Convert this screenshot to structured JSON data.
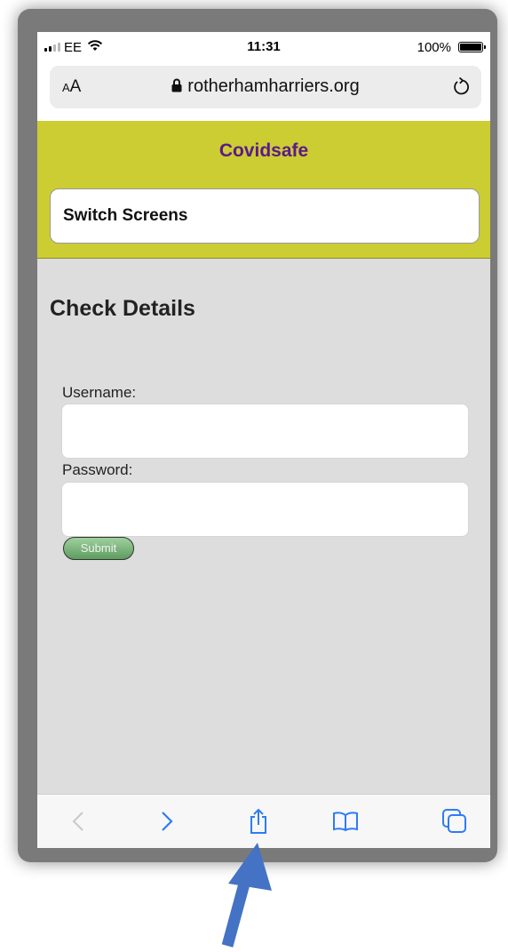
{
  "status_bar": {
    "carrier": "EE",
    "time": "11:31",
    "battery": "100%"
  },
  "browser": {
    "text_size_button": "AA",
    "url": "rotherhamharriers.org"
  },
  "app": {
    "title": "Covidsafe",
    "title_color": "#5a1a8a",
    "header_color": "#cccc33",
    "switch_screens_label": "Switch Screens"
  },
  "page": {
    "heading": "Check Details",
    "username_label": "Username:",
    "username_value": "",
    "password_label": "Password:",
    "password_value": "",
    "submit_label": "Submit"
  },
  "toolbar": {
    "items": [
      "back-icon",
      "forward-icon",
      "share-icon",
      "bookmarks-icon",
      "tabs-icon"
    ],
    "accent_color": "#2f7bf5"
  },
  "annotation": {
    "arrow_color": "#4472c4"
  }
}
